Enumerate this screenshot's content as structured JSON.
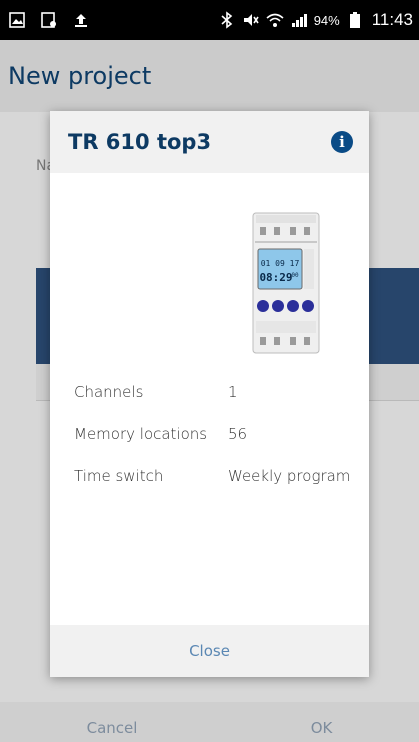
{
  "status_bar": {
    "battery_percent": "94%",
    "time": "11:43",
    "icons": [
      "image-icon",
      "screencast-icon",
      "upload-icon",
      "bluetooth-icon",
      "mute-icon",
      "wifi-icon",
      "signal-icon",
      "battery-icon"
    ]
  },
  "app": {
    "title": "New project",
    "name_label": "Na",
    "cancel_label": "Cancel",
    "ok_label": "OK"
  },
  "dialog": {
    "title": "TR 610 top3",
    "close_label": "Close",
    "device_display": {
      "date": "01 09 17",
      "time": "08:29",
      "seconds": "00"
    },
    "specs": [
      {
        "label": "Channels",
        "value": "1"
      },
      {
        "label": "Memory locations",
        "value": "56"
      },
      {
        "label": "Time switch",
        "value": "Weekly program"
      }
    ]
  },
  "colors": {
    "title_blue": "#0d3a63",
    "info_blue": "#0a4b86",
    "link_blue": "#5a87b3"
  }
}
